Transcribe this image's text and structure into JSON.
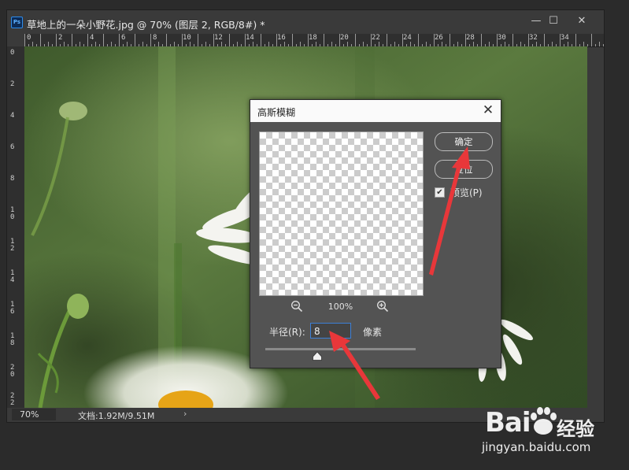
{
  "window": {
    "title": "草地上的一朵小野花.jpg @ 70% (图层 2, RGB/8#) *",
    "app_icon": "Ps",
    "controls": {
      "minimize": "—",
      "maximize": "☐",
      "close": "✕"
    }
  },
  "rulers": {
    "horizontal": [
      "0",
      "2",
      "4",
      "6",
      "8",
      "10",
      "12",
      "14",
      "16",
      "18",
      "20",
      "22",
      "24",
      "26",
      "28",
      "30",
      "32",
      "34"
    ],
    "vertical": [
      "0",
      "2",
      "4",
      "6",
      "8",
      "10",
      "12",
      "14",
      "16",
      "18",
      "20",
      "22"
    ]
  },
  "status": {
    "zoom": "70%",
    "doc_info": "文档:1.92M/9.51M",
    "arrow": "›"
  },
  "dialog": {
    "title": "高斯模糊",
    "close": "✕",
    "ok_label": "确定",
    "reset_label": "复位",
    "preview_label": "预览(P)",
    "preview_checked": true,
    "zoom_percent": "100%",
    "radius_label": "半径(R):",
    "radius_value": "8",
    "radius_unit": "像素"
  },
  "watermark": {
    "brand": "Bai",
    "brand_cn": "经验",
    "url": "jingyan.baidu.com"
  },
  "colors": {
    "annotation_arrow": "#e8373a",
    "focus_border": "#3d7fd6"
  }
}
